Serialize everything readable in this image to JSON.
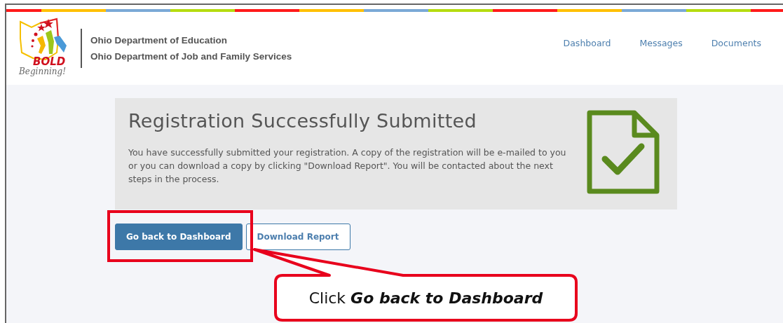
{
  "header": {
    "logo": {
      "title": "BOLD",
      "tagline": "Beginning!"
    },
    "organizations": [
      "Ohio Department of Education",
      "Ohio Department of Job and Family Services"
    ],
    "nav": [
      {
        "label": "Dashboard"
      },
      {
        "label": "Messages"
      },
      {
        "label": "Documents"
      }
    ]
  },
  "confirmation": {
    "title": "Registration Successfully Submitted",
    "message": "You have successfully submitted your registration. A copy of the registration will be e-mailed to you or you can download a copy by clicking \"Download Report\". You will be contacted about the next steps in the process."
  },
  "buttons": [
    {
      "label": "Go back to Dashboard",
      "kind": "primary"
    },
    {
      "label": "Download Report",
      "kind": "secondary"
    }
  ],
  "annotation": {
    "text": "Click *Go back to Dashboard*"
  }
}
